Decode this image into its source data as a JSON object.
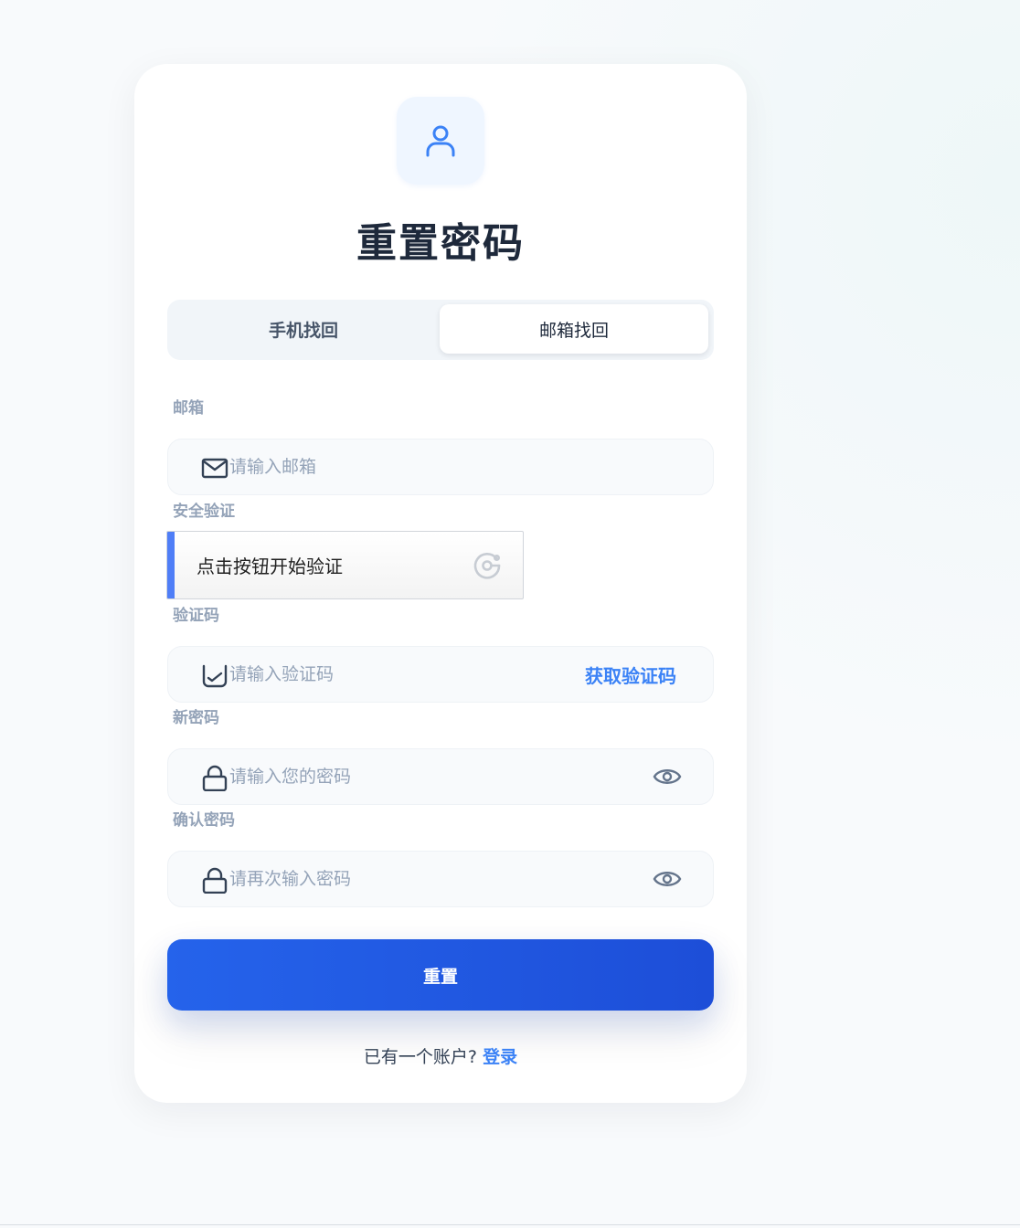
{
  "page": {
    "title": "重置密码"
  },
  "tabs": [
    {
      "label": "手机找回",
      "active": false
    },
    {
      "label": "邮箱找回",
      "active": true
    }
  ],
  "form": {
    "email": {
      "label": "邮箱",
      "placeholder": "请输入邮箱",
      "value": "",
      "icon": "mail-icon"
    },
    "security": {
      "label": "安全验证",
      "captcha_text": "点击按钮开始验证",
      "icon": "captcha-icon"
    },
    "code": {
      "label": "验证码",
      "placeholder": "请输入验证码",
      "value": "",
      "get_code_label": "获取验证码",
      "icon": "shield-check-icon"
    },
    "new_password": {
      "label": "新密码",
      "placeholder": "请输入您的密码",
      "value": "",
      "icon": "lock-icon"
    },
    "confirm_password": {
      "label": "确认密码",
      "placeholder": "请再次输入密码",
      "value": "",
      "icon": "lock-icon"
    }
  },
  "submit_label": "重置",
  "footer": {
    "prompt": "已有一个账户?",
    "login_label": "登录"
  },
  "colors": {
    "accent": "#3b82f6",
    "button": "#2563eb",
    "title": "#1e293b",
    "label": "#94a3b8",
    "captcha_bar": "#4f7ef7"
  }
}
